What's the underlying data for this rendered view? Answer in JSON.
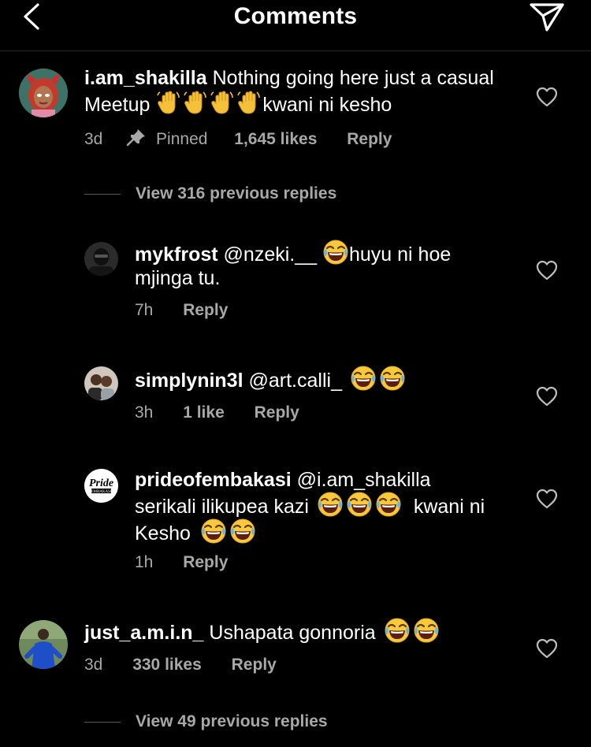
{
  "header": {
    "title": "Comments",
    "back_icon": "chevron-left-icon",
    "send_icon": "paper-plane-icon"
  },
  "comments": [
    {
      "username": "i.am_shakilla",
      "text_before": "Nothing going here just a casual Meetup",
      "emoji_1": "waving-hand-emoji",
      "text_after": "kwani ni kesho",
      "time": "3d",
      "pinned_label": "Pinned",
      "likes": "1,645 likes",
      "reply_label": "Reply",
      "view_replies": "View 316 previous replies"
    },
    {
      "username": "mykfrost",
      "mention": "@nzeki.__",
      "emoji": "laughing-tears-emoji",
      "text_after": "huyu ni hoe mjinga tu.",
      "time": "7h",
      "reply_label": "Reply"
    },
    {
      "username": "simplynin3l",
      "mention": "@art.calli_",
      "time": "3h",
      "likes": "1 like",
      "reply_label": "Reply"
    },
    {
      "username": "prideofembakasi",
      "mention": "@i.am_shakilla",
      "text_mid": "serikali ilikupea kazi",
      "text_after": "kwani ni",
      "text_last": "Kesho",
      "avatar_logo_text": "Pride EMBAKASI",
      "time": "1h",
      "reply_label": "Reply"
    },
    {
      "username": "just_a.m.i.n_",
      "text": "Ushapata gonnoria",
      "time": "3d",
      "likes": "330 likes",
      "reply_label": "Reply",
      "view_replies": "View 49 previous replies"
    }
  ],
  "colors": {
    "background": "#000000",
    "text": "#ffffff",
    "secondary_text": "#a8a8a8",
    "divider": "#262626"
  }
}
